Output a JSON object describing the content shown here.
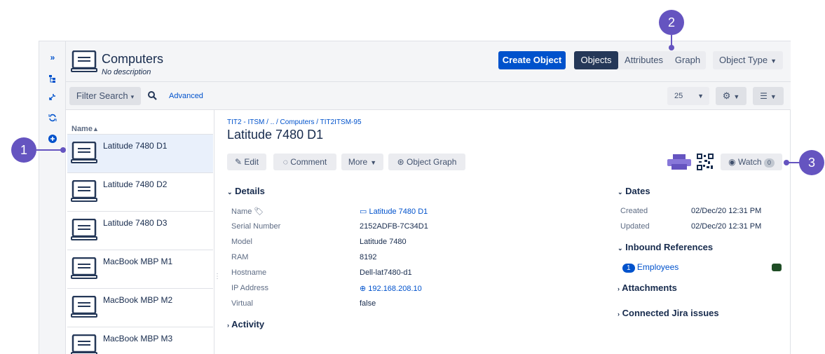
{
  "header": {
    "title": "Computers",
    "description": "No description",
    "create_label": "Create Object",
    "tabs": [
      "Objects",
      "Attributes",
      "Graph"
    ],
    "object_type_label": "Object Type"
  },
  "toolbar": {
    "filter_label": "Filter Search",
    "advanced_label": "Advanced",
    "page_size": "25"
  },
  "list": {
    "header": "Name",
    "items": [
      "Latitude 7480 D1",
      "Latitude 7480 D2",
      "Latitude 7480 D3",
      "MacBook MBP M1",
      "MacBook MBP M2",
      "MacBook MBP M3"
    ]
  },
  "detail": {
    "breadcrumb": "TIT2 - ITSM / .. / Computers / TIT2ITSM-95",
    "title": "Latitude 7480 D1",
    "actions": {
      "edit": "Edit",
      "comment": "Comment",
      "more": "More",
      "graph": "Object Graph",
      "watch": "Watch",
      "watch_count": "0"
    },
    "details_heading": "Details",
    "fields": [
      {
        "label": "Name",
        "value": "Latitude 7480 D1"
      },
      {
        "label": "Serial Number",
        "value": "2152ADFB-7C34D1"
      },
      {
        "label": "Model",
        "value": "Latitude 7480"
      },
      {
        "label": "RAM",
        "value": "8192"
      },
      {
        "label": "Hostname",
        "value": "Dell-lat7480-d1"
      },
      {
        "label": "IP Address",
        "value": "192.168.208.10"
      },
      {
        "label": "Virtual",
        "value": "false"
      }
    ],
    "activity_heading": "Activity",
    "dates_heading": "Dates",
    "created_label": "Created",
    "created_value": "02/Dec/20 12:31 PM",
    "updated_label": "Updated",
    "updated_value": "02/Dec/20 12:31 PM",
    "inbound_heading": "Inbound References",
    "inbound_count": "1",
    "inbound_label": "Employees",
    "attachments_heading": "Attachments",
    "jira_heading": "Connected Jira issues"
  },
  "callouts": [
    "1",
    "2",
    "3"
  ],
  "colors": {
    "primary": "#0052cc",
    "callout": "#6554c0",
    "selected_row": "#e9f0fb",
    "tab_active": "#253858"
  }
}
